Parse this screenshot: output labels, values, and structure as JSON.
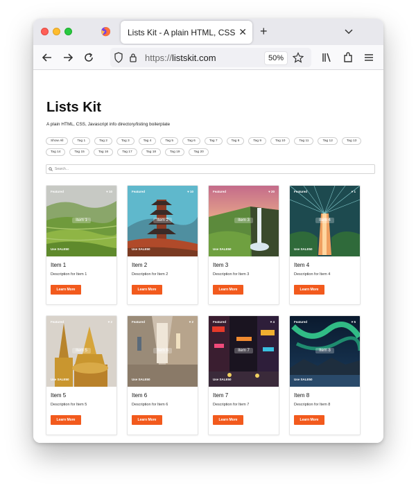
{
  "browser": {
    "tab_title": "Lists Kit - A plain HTML, CSS, Javascript",
    "tab_close": "✕",
    "new_tab": "+",
    "url_prefix": "https://",
    "url_host": "listskit.com",
    "zoom": "50%"
  },
  "page": {
    "title": "Lists Kit",
    "subtitle": "A plain HTML, CSS, Javascript info directory/listing boilerplate"
  },
  "tags": [
    "Show All",
    "Tag 1",
    "Tag 2",
    "Tag 3",
    "Tag 4",
    "Tag 5",
    "Tag 6",
    "Tag 7",
    "Tag 8",
    "Tag 9",
    "Tag 10",
    "Tag 11",
    "Tag 12",
    "Tag 13",
    "Tag 14",
    "Tag 15",
    "Tag 16",
    "Tag 17",
    "Tag 18",
    "Tag 19",
    "Tag 20"
  ],
  "search": {
    "placeholder": "Search..."
  },
  "cards": [
    {
      "featured": "Featured",
      "likes": "♥ 10",
      "label": "Item 1",
      "promo": "Use SALE50",
      "title": "Item 1",
      "desc": "Description for Item 1",
      "button": "Learn More",
      "scene": "terraces"
    },
    {
      "featured": "Featured",
      "likes": "♥ 10",
      "label": "Item 2",
      "promo": "Use SALE50",
      "title": "Item 2",
      "desc": "Description for Item 2",
      "button": "Learn More",
      "scene": "pagoda"
    },
    {
      "featured": "Featured",
      "likes": "♥ 20",
      "label": "Item 3",
      "promo": "Use SALE50",
      "title": "Item 3",
      "desc": "Description for Item 3",
      "button": "Learn More",
      "scene": "waterfall"
    },
    {
      "featured": "Featured",
      "likes": "♥ 1",
      "label": "Item 4",
      "promo": "Use SALE50",
      "title": "Item 4",
      "desc": "Description for Item 4",
      "button": "Learn More",
      "scene": "dome"
    },
    {
      "featured": "Featured",
      "likes": "♥ 2",
      "label": "Item 5",
      "promo": "Use SALE50",
      "title": "Item 5",
      "desc": "Description for Item 5",
      "button": "Learn More",
      "scene": "stupa"
    },
    {
      "featured": "Featured",
      "likes": "♥ 2",
      "label": "Item 6",
      "promo": "Use SALE50",
      "title": "Item 6",
      "desc": "Description for Item 6",
      "button": "Learn More",
      "scene": "street"
    },
    {
      "featured": "Featured",
      "likes": "♥ 4",
      "label": "Item 7",
      "promo": "Use SALE50",
      "title": "Item 7",
      "desc": "Description for Item 7",
      "button": "Learn More",
      "scene": "night"
    },
    {
      "featured": "Featured",
      "likes": "♥ 5",
      "label": "Item 8",
      "promo": "Use SALE50",
      "title": "Item 8",
      "desc": "Description for Item 8",
      "button": "Learn More",
      "scene": "aurora"
    }
  ],
  "partial_cards": [
    {
      "featured": "Featured",
      "likes": "♥ 1"
    },
    {
      "featured": "Featured",
      "likes": ""
    },
    {
      "featured": "Featured",
      "likes": "♥ 1"
    },
    {
      "featured": "Featured",
      "likes": "♥ 2"
    }
  ],
  "colors": {
    "accent": "#f25a1d",
    "tab_bar": "#e8e8ed",
    "nav_bar": "#f9f9fb"
  }
}
